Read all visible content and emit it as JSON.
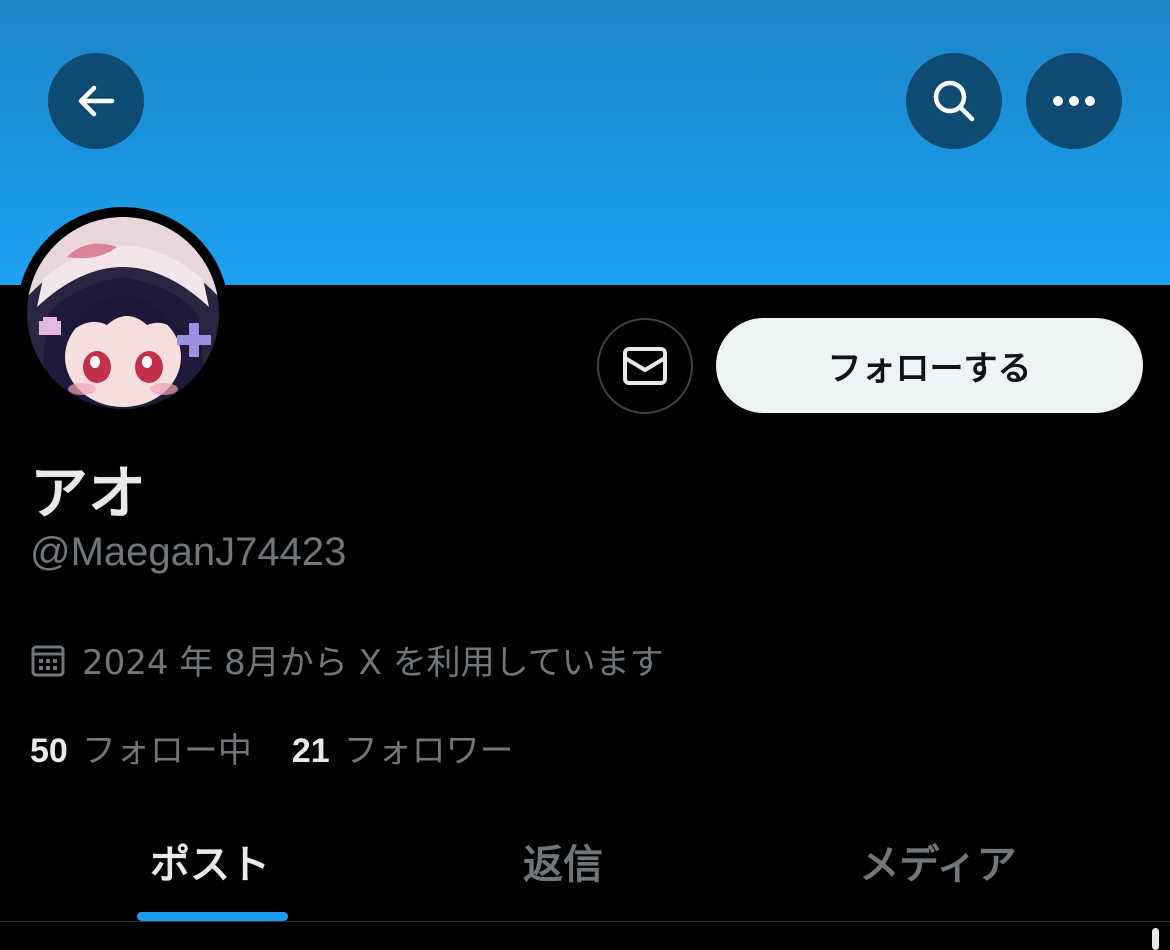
{
  "header": {
    "back_icon": "arrow-left-icon",
    "search_icon": "search-icon",
    "more_icon": "more-horizontal-icon"
  },
  "profile": {
    "display_name": "アオ",
    "handle": "@MaeganJ74423",
    "joined": "2024 年 8月から X を利用しています",
    "joined_icon": "calendar-icon",
    "following_count": "50",
    "following_label": "フォロー中",
    "followers_count": "21",
    "followers_label": "フォロワー"
  },
  "actions": {
    "dm_icon": "envelope-icon",
    "follow_label": "フォローする"
  },
  "tabs": [
    {
      "label": "ポスト",
      "active": true
    },
    {
      "label": "返信",
      "active": false
    },
    {
      "label": "メディア",
      "active": false
    }
  ],
  "colors": {
    "banner": "#1da1f2",
    "accent": "#1d9bf0",
    "background": "#000000",
    "text_primary": "#e7e9ea",
    "text_secondary": "#71767b"
  }
}
